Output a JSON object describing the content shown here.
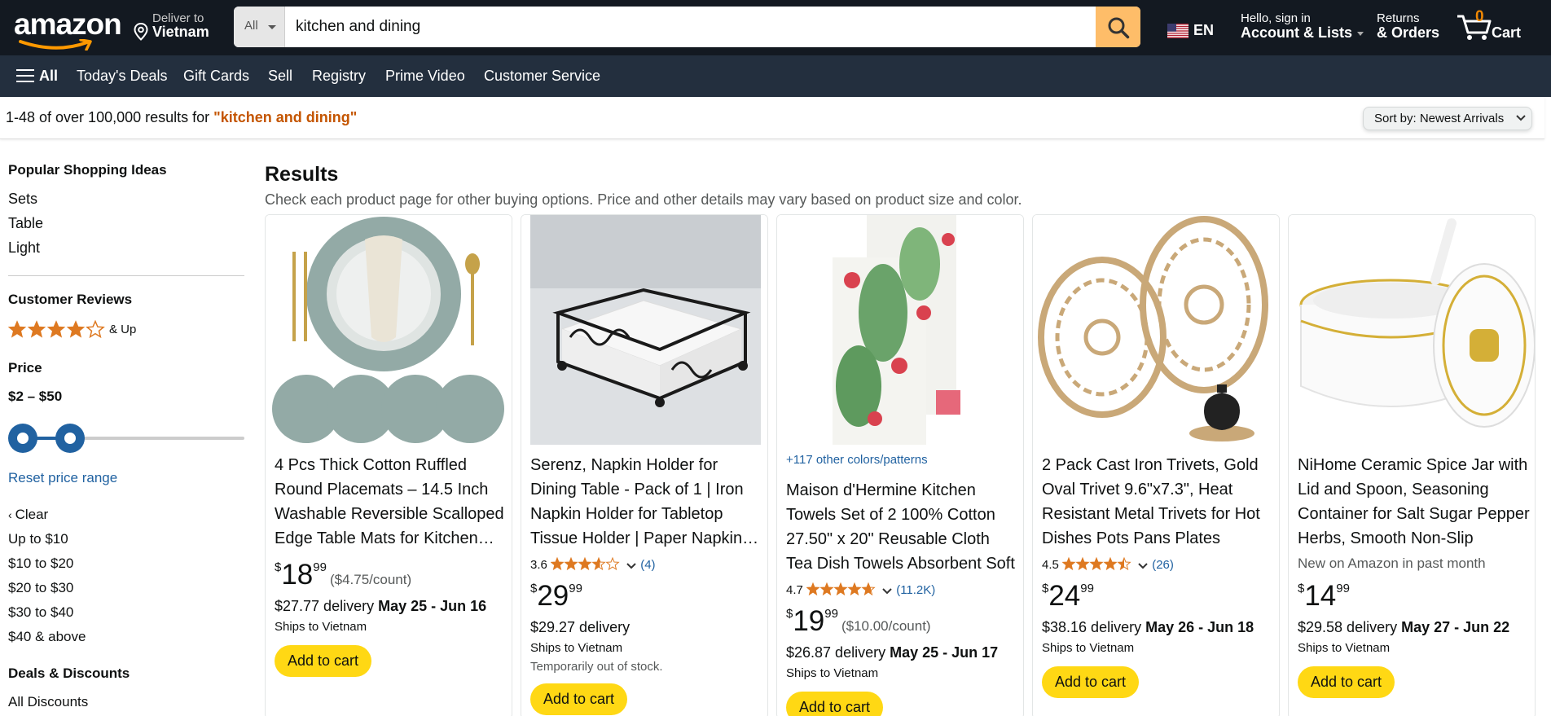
{
  "header": {
    "logo": "amazon",
    "deliver_line1": "Deliver to",
    "deliver_line2": "Vietnam",
    "search_category": "All",
    "search_value": "kitchen and dining",
    "lang": "EN",
    "account_line1": "Hello, sign in",
    "account_line2": "Account & Lists",
    "orders_line1": "Returns",
    "orders_line2": "& Orders",
    "cart_count": "0",
    "cart_label": "Cart"
  },
  "subnav": {
    "all": "All",
    "items": [
      "Today's Deals",
      "Gift Cards",
      "Sell",
      "Registry",
      "Prime Video",
      "Customer Service"
    ]
  },
  "results_bar": {
    "prefix": "1-48 of over 100,000 results for ",
    "query": "\"kitchen and dining\"",
    "sort_label": "Sort by:  Newest Arrivals"
  },
  "sidebar": {
    "popular_heading": "Popular Shopping Ideas",
    "popular": [
      "Sets",
      "Table",
      "Light"
    ],
    "reviews_heading": "Customer Reviews",
    "reviews_stars": 4,
    "reviews_andup": "& Up",
    "price_heading": "Price",
    "price_range": "$2 – $50",
    "reset": "Reset price range",
    "clear": "Clear",
    "price_links": [
      "Up to $10",
      "$10 to $20",
      "$20 to $30",
      "$30 to $40",
      "$40 & above"
    ],
    "deals_heading": "Deals & Discounts",
    "deals_link": "All Discounts"
  },
  "main": {
    "heading": "Results",
    "subheading": "Check each product page for other buying options. Price and other details may vary based on product size and color."
  },
  "products": [
    {
      "title": "4 Pcs Thick Cotton Ruffled Round Placemats – 14.5 Inch Washable Reversible Scalloped Edge Table Mats for Kitchen Dining",
      "price_whole": "18",
      "price_frac": "99",
      "unit": "($4.75/count)",
      "delivery": "$27.77 delivery ",
      "delivery_date": "May 25 - Jun 16",
      "ships": "Ships to Vietnam",
      "cta": "Add to cart"
    },
    {
      "title": "Serenz, Napkin Holder for Dining Table - Pack of 1 | Iron Napkin Holder for Tabletop Tissue Holder | Paper Napkin Holder",
      "rating": "3.6",
      "rating_count": "(4)",
      "rating_value": 3.6,
      "price_whole": "29",
      "price_frac": "99",
      "delivery": "$29.27 delivery",
      "ships": "Ships to Vietnam",
      "note": "Temporarily out of stock.",
      "cta": "Add to cart"
    },
    {
      "colors": "+117 other colors/patterns",
      "title": "Maison d'Hermine Kitchen Towels Set of 2 100% Cotton 27.50\" x 20\" Reusable Cloth Tea Dish Towels Absorbent Soft",
      "rating": "4.7",
      "rating_count": "(11.2K)",
      "rating_value": 4.7,
      "price_whole": "19",
      "price_frac": "99",
      "unit": "($10.00/count)",
      "delivery": "$26.87 delivery ",
      "delivery_date": "May 25 - Jun 17",
      "ships": "Ships to Vietnam",
      "cta": "Add to cart"
    },
    {
      "title": "2 Pack Cast Iron Trivets, Gold Oval Trivet 9.6\"x7.3\", Heat Resistant Metal Trivets for Hot Dishes Pots Pans Plates",
      "rating": "4.5",
      "rating_count": "(26)",
      "rating_value": 4.5,
      "price_whole": "24",
      "price_frac": "99",
      "delivery": "$38.16 delivery ",
      "delivery_date": "May 26 - Jun 18",
      "ships": "Ships to Vietnam",
      "cta": "Add to cart"
    },
    {
      "title": "NiHome Ceramic Spice Jar with Lid and Spoon, Seasoning Container for Salt Sugar Pepper Herbs, Smooth Non-Slip",
      "newtag": "New on Amazon in past month",
      "price_whole": "14",
      "price_frac": "99",
      "delivery": "$29.58 delivery ",
      "delivery_date": "May 27 - Jun 22",
      "ships": "Ships to Vietnam",
      "cta": "Add to cart"
    }
  ],
  "colors": {
    "nav_dark": "#131921",
    "nav_sub": "#232f3e",
    "search_btn": "#febd69",
    "cta": "#ffd814",
    "link": "#2162a1",
    "star": "#de7921",
    "query": "#c45500"
  }
}
